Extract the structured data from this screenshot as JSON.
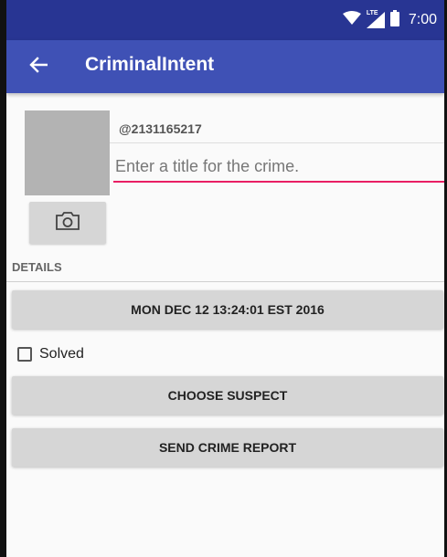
{
  "status_bar": {
    "time": "7:00",
    "network_label": "LTE",
    "icons": [
      "wifi-icon",
      "cell-signal-icon",
      "battery-icon"
    ],
    "background_color": "#283593"
  },
  "app_bar": {
    "title": "CriminalIntent",
    "back_icon": "arrow-back-icon",
    "background_color": "#3f51b5"
  },
  "crime": {
    "title_label": "@2131165217",
    "title_placeholder": "Enter a title for the crime.",
    "title_value": "",
    "photo_icon": "camera-icon",
    "accent_color": "#e91e63"
  },
  "details": {
    "section_label": "DETAILS",
    "date_button": "MON DEC 12 13:24:01 EST 2016",
    "solved_label": "Solved",
    "solved_checked": false,
    "suspect_button": "CHOOSE SUSPECT",
    "report_button": "SEND CRIME REPORT"
  }
}
